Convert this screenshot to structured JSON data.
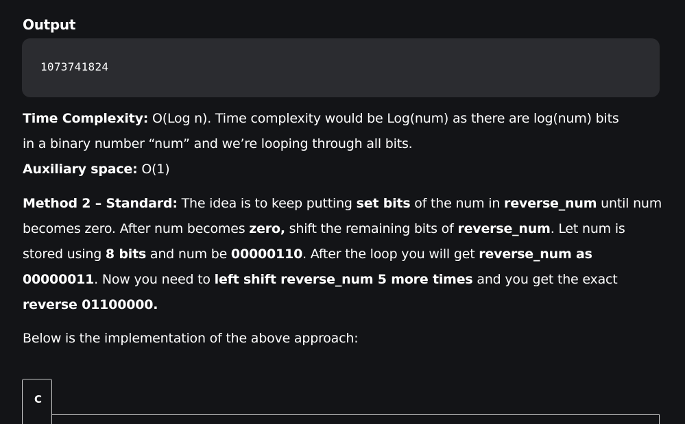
{
  "output": {
    "heading": "Output",
    "value": "1073741824"
  },
  "complexity": {
    "time_label": "Time Complexity:",
    "time_text_1": " O(Log n). Time complexity would be Log(num) as there are log(num) bits",
    "time_text_2": "in a binary number “num” and we’re looping through all bits.",
    "space_label": "Auxiliary space:",
    "space_text": " O(1)"
  },
  "method2": {
    "l1_b1": "Method 2 – Standard:",
    "l1_t1": " The idea is to keep putting ",
    "l1_b2": "set bits",
    "l1_t2": " of the num in ",
    "l1_b3": "reverse_num",
    "l1_t3": " until num",
    "l2_t1": "becomes zero. After num becomes ",
    "l2_b1": "zero,",
    "l2_t2": " shift the remaining bits of ",
    "l2_b2": "reverse_num",
    "l2_t3": ". Let num is",
    "l3_t1": "stored using ",
    "l3_b1": "8 bits",
    "l3_t2": " and num be ",
    "l3_b2": "00000110",
    "l3_t3": ". After the loop you will get ",
    "l3_b3": "reverse_num as",
    "l4_b1": "00000011",
    "l4_t1": ". Now you need to ",
    "l4_b2": "left shift reverse_num 5 more times",
    "l4_t2": " and you get the exact",
    "l5_b1": "reverse 01100000."
  },
  "implementation_intro": "Below is the implementation of the above approach:",
  "code_tabs": [
    {
      "label": "C"
    }
  ]
}
